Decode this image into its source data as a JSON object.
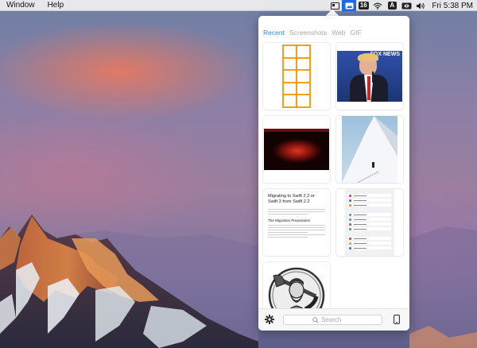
{
  "menubar": {
    "menus": [
      "Window",
      "Help"
    ],
    "status": {
      "calendar_badge": "16",
      "input_source": "A",
      "clock": "Fri 5:38 PM"
    }
  },
  "panel": {
    "tabs": [
      {
        "label": "Recent",
        "active": true
      },
      {
        "label": "Screenshots",
        "active": false
      },
      {
        "label": "Web",
        "active": false
      },
      {
        "label": "GIF",
        "active": false
      }
    ],
    "thumbnails": [
      {
        "kind": "app-screenshots-grid"
      },
      {
        "kind": "news-photo",
        "overlay_text": "FOX NEWS"
      },
      {
        "kind": "dark-red-image"
      },
      {
        "kind": "snow-slope-photo"
      },
      {
        "kind": "document",
        "title": "Migrating to Swift 2.3 or Swift 3 from Swift 2.2",
        "subheading": "The Migration Preparation"
      },
      {
        "kind": "ios-settings-screenshot"
      },
      {
        "kind": "lumberjack-logo"
      }
    ],
    "search": {
      "placeholder": "Search"
    }
  },
  "colors": {
    "accent": "#2f8fd8",
    "menubar_active": "#1d6ae6",
    "tab_inactive": "#a9a9a9"
  },
  "icons": {
    "menubar": [
      "photos-icon",
      "screenshot-manager-icon",
      "calendar-icon",
      "wifi-icon",
      "input-source-icon",
      "display-mirroring-icon",
      "volume-icon"
    ],
    "bottombar": [
      "gear-icon",
      "search-icon",
      "phone-icon"
    ]
  }
}
